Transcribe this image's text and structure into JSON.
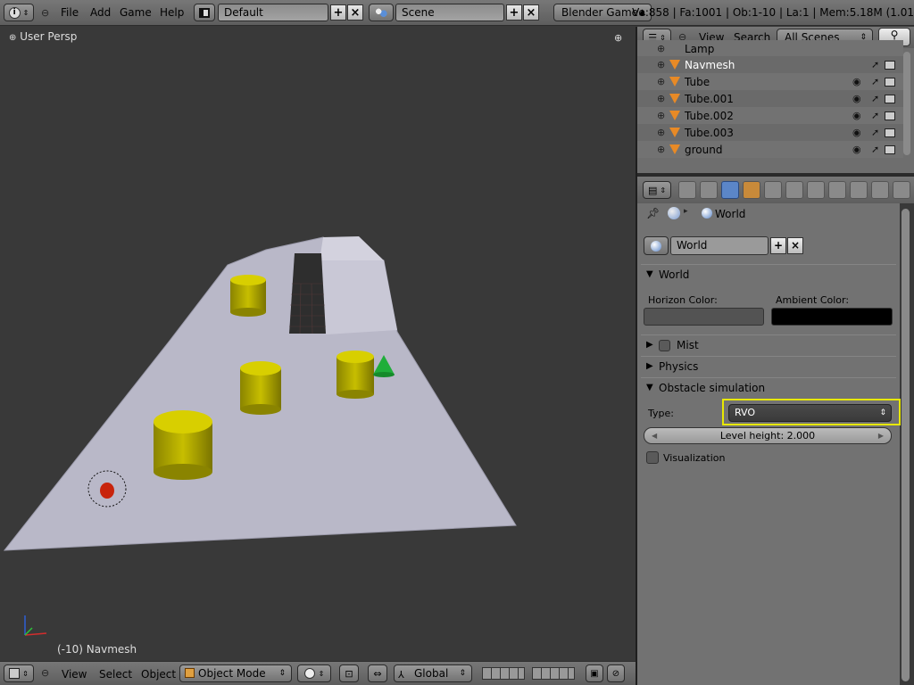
{
  "header": {
    "menus": [
      "File",
      "Add",
      "Game",
      "Help"
    ],
    "screen_layout": "Default",
    "scene": "Scene",
    "engine": "Blender Game",
    "stats": "Ve:858 | Fa:1001 | Ob:1-10 | La:1 | Mem:5.18M (1.01"
  },
  "viewport": {
    "title": "User Persp",
    "object_label": "(-10) Navmesh"
  },
  "bottom_bar": {
    "menus": [
      "View",
      "Select",
      "Object"
    ],
    "mode": "Object Mode",
    "orientation": "Global"
  },
  "outliner": {
    "menus": [
      "View",
      "Search"
    ],
    "filter": "All Scenes",
    "items": [
      {
        "name": "Lamp"
      },
      {
        "name": "Navmesh"
      },
      {
        "name": "Tube"
      },
      {
        "name": "Tube.001"
      },
      {
        "name": "Tube.002"
      },
      {
        "name": "Tube.003"
      },
      {
        "name": "ground"
      }
    ]
  },
  "properties": {
    "breadcrumb": "World",
    "world_name": "World",
    "panels": {
      "world": "World",
      "horizon_label": "Horizon Color:",
      "ambient_label": "Ambient Color:",
      "mist": "Mist",
      "physics": "Physics",
      "obstacle": "Obstacle simulation",
      "type_label": "Type:",
      "type_value": "RVO",
      "level_height": "Level height: 2.000",
      "visualization": "Visualization"
    },
    "colors": {
      "horizon": "#535353",
      "ambient": "#000000",
      "highlight": "#e8e800"
    }
  }
}
